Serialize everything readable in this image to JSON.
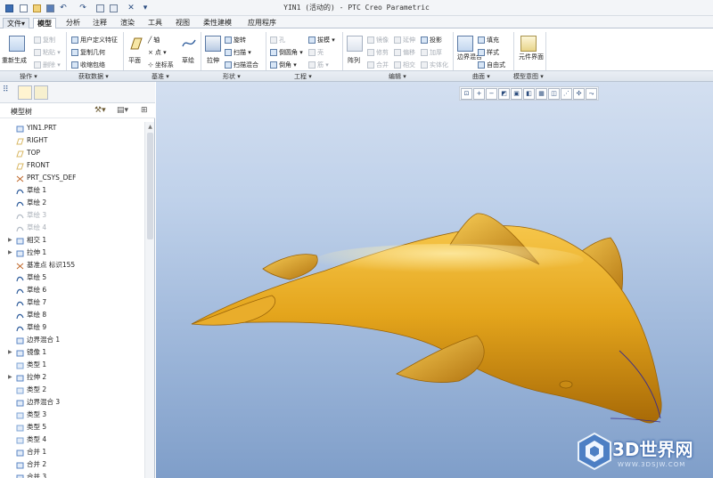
{
  "window": {
    "title": "YIN1 (活动的) - PTC Creo Parametric"
  },
  "ribbon": {
    "tabs": [
      "文件▾",
      "模型",
      "分析",
      "注释",
      "渲染",
      "工具",
      "视图",
      "柔性建模",
      "应用程序"
    ],
    "active_tab": "模型",
    "groups": {
      "operation": {
        "label": "操作 ▾",
        "regen": "重新生成",
        "copy": "复制",
        "paste": "粘贴 ▾",
        "delete": "删除 ▾"
      },
      "get_data": {
        "label": "获取数据 ▾",
        "udf": "用户定义特征",
        "copy_geom": "复制几何",
        "shrinkwrap": "收缩包络"
      },
      "datum": {
        "label": "基准 ▾",
        "plane": "平面",
        "axis": "轴",
        "point": "点 ▾",
        "csys": "坐标系",
        "sketch": "草绘"
      },
      "shapes": {
        "label": "形状 ▾",
        "extrude": "拉伸",
        "revolve": "旋转",
        "sweep": "扫描 ▾",
        "swept_blend": "扫描混合"
      },
      "engineering": {
        "label": "工程 ▾",
        "hole": "孔",
        "round": "倒圆角 ▾",
        "chamfer": "倒角 ▾",
        "draft": "拔模 ▾",
        "shell": "壳",
        "rib": "筋 ▾"
      },
      "editing": {
        "label": "编辑 ▾",
        "pattern": "阵列",
        "mirror": "镜像",
        "extend": "延伸",
        "project": "投影",
        "trim": "修剪",
        "offset": "偏移",
        "thicken": "加厚",
        "merge": "合并",
        "intersect": "相交",
        "solidify": "实体化"
      },
      "surfaces": {
        "label": "曲面 ▾",
        "boundary_blend": "边界混合",
        "fill": "填充",
        "style": "样式",
        "freestyle": "自由式"
      },
      "model_intent": {
        "label": "模型意图 ▾",
        "component_interface": "元件界面"
      }
    }
  },
  "model_tree": {
    "title": "模型树",
    "items": [
      {
        "label": "YIN1.PRT",
        "icon": "part-icon",
        "expander": "",
        "dim": false
      },
      {
        "label": "RIGHT",
        "icon": "datum-plane-icon",
        "expander": "",
        "dim": false
      },
      {
        "label": "TOP",
        "icon": "datum-plane-icon",
        "expander": "",
        "dim": false
      },
      {
        "label": "FRONT",
        "icon": "datum-plane-icon",
        "expander": "",
        "dim": false
      },
      {
        "label": "PRT_CSYS_DEF",
        "icon": "csys-icon",
        "expander": "",
        "dim": false
      },
      {
        "label": "草绘 1",
        "icon": "sketch-icon",
        "expander": "",
        "dim": false
      },
      {
        "label": "草绘 2",
        "icon": "sketch-icon",
        "expander": "",
        "dim": false
      },
      {
        "label": "草绘 3",
        "icon": "sketch-hidden-icon",
        "expander": "",
        "dim": true
      },
      {
        "label": "草绘 4",
        "icon": "sketch-hidden-icon",
        "expander": "",
        "dim": true
      },
      {
        "label": "相交 1",
        "icon": "intersect-icon",
        "expander": "▶",
        "dim": false
      },
      {
        "label": "拉伸 1",
        "icon": "extrude-icon",
        "expander": "▶",
        "dim": false
      },
      {
        "label": "基准点 标识155",
        "icon": "datum-point-icon",
        "expander": "",
        "dim": false
      },
      {
        "label": "草绘 5",
        "icon": "sketch-icon",
        "expander": "",
        "dim": false
      },
      {
        "label": "草绘 6",
        "icon": "sketch-icon",
        "expander": "",
        "dim": false
      },
      {
        "label": "草绘 7",
        "icon": "sketch-icon",
        "expander": "",
        "dim": false
      },
      {
        "label": "草绘 8",
        "icon": "sketch-icon",
        "expander": "",
        "dim": false
      },
      {
        "label": "草绘 9",
        "icon": "sketch-icon",
        "expander": "",
        "dim": false
      },
      {
        "label": "边界混合 1",
        "icon": "boundary-blend-icon",
        "expander": "",
        "dim": false
      },
      {
        "label": "镜像 1",
        "icon": "mirror-icon",
        "expander": "▶",
        "dim": false
      },
      {
        "label": "类型 1",
        "icon": "style-icon",
        "expander": "",
        "dim": false
      },
      {
        "label": "拉伸 2",
        "icon": "extrude-icon",
        "expander": "▶",
        "dim": false
      },
      {
        "label": "类型 2",
        "icon": "style-icon",
        "expander": "",
        "dim": false
      },
      {
        "label": "边界混合 3",
        "icon": "boundary-blend-icon",
        "expander": "",
        "dim": false
      },
      {
        "label": "类型 3",
        "icon": "style-icon",
        "expander": "",
        "dim": false
      },
      {
        "label": "类型 5",
        "icon": "style-icon",
        "expander": "",
        "dim": false
      },
      {
        "label": "类型 4",
        "icon": "style-icon",
        "expander": "",
        "dim": false
      },
      {
        "label": "合并 1",
        "icon": "merge-icon",
        "expander": "",
        "dim": false
      },
      {
        "label": "合并 2",
        "icon": "merge-icon",
        "expander": "",
        "dim": false
      },
      {
        "label": "合并 3",
        "icon": "merge-icon",
        "expander": "",
        "dim": false
      }
    ]
  },
  "watermark": {
    "text": "3D世界网",
    "url": "WWW.3DSJW.COM"
  },
  "colors": {
    "model": "#e0a11a",
    "background_top": "#d3dff0",
    "background_bottom": "#7f9ec9"
  }
}
